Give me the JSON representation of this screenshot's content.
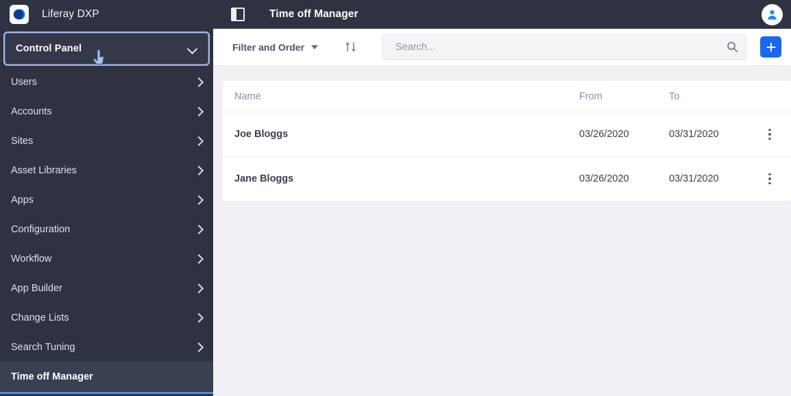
{
  "sidebar": {
    "brand": {
      "title": "Liferay DXP",
      "logo_icon": "liferay-logo-icon",
      "logo_bg": "#ffffff",
      "logo_color_outer": "#1b72d9",
      "logo_color_inner": "#0b3d91"
    },
    "control_panel": {
      "label": "Control Panel",
      "chevron_icon": "chevron-down-icon",
      "focus_ring_color": "#a5bdf0"
    },
    "cursor_icon": "pointing-hand-cursor",
    "background": "#2e3241",
    "active_background": "#3b4050",
    "active_underline_color": "#4a90e2",
    "items": [
      {
        "label": "Users",
        "chevron_icon": "chevron-right-icon",
        "active": false
      },
      {
        "label": "Accounts",
        "chevron_icon": "chevron-right-icon",
        "active": false
      },
      {
        "label": "Sites",
        "chevron_icon": "chevron-right-icon",
        "active": false
      },
      {
        "label": "Asset Libraries",
        "chevron_icon": "chevron-right-icon",
        "active": false
      },
      {
        "label": "Apps",
        "chevron_icon": "chevron-right-icon",
        "active": false
      },
      {
        "label": "Configuration",
        "chevron_icon": "chevron-right-icon",
        "active": false
      },
      {
        "label": "Workflow",
        "chevron_icon": "chevron-right-icon",
        "active": false
      },
      {
        "label": "App Builder",
        "chevron_icon": "chevron-right-icon",
        "active": false
      },
      {
        "label": "Change Lists",
        "chevron_icon": "chevron-right-icon",
        "active": false
      },
      {
        "label": "Search Tuning",
        "chevron_icon": "chevron-right-icon",
        "active": false
      },
      {
        "label": "Time off Manager",
        "chevron_icon": "",
        "active": true
      }
    ]
  },
  "topbar": {
    "panel_toggle_icon": "sidebar-toggle-icon",
    "title": "Time off Manager",
    "avatar_icon": "user-avatar-icon",
    "avatar_color": "#2b87f5",
    "background": "#2e3241"
  },
  "toolbar": {
    "filter_label": "Filter and Order",
    "filter_caret_icon": "caret-down-icon",
    "sort_icon": "sort-ascending-descending-icon",
    "search": {
      "value": "",
      "placeholder": "Search...",
      "icon": "search-icon"
    },
    "add_button": {
      "label": "+",
      "icon": "plus-icon",
      "color": "#1c66f0"
    }
  },
  "table": {
    "columns": [
      "Name",
      "From",
      "To"
    ],
    "rows": [
      {
        "name": "Joe Bloggs",
        "from": "03/26/2020",
        "to": "03/31/2020",
        "menu_icon": "kebab-menu-icon"
      },
      {
        "name": "Jane Bloggs",
        "from": "03/26/2020",
        "to": "03/31/2020",
        "menu_icon": "kebab-menu-icon"
      }
    ]
  }
}
